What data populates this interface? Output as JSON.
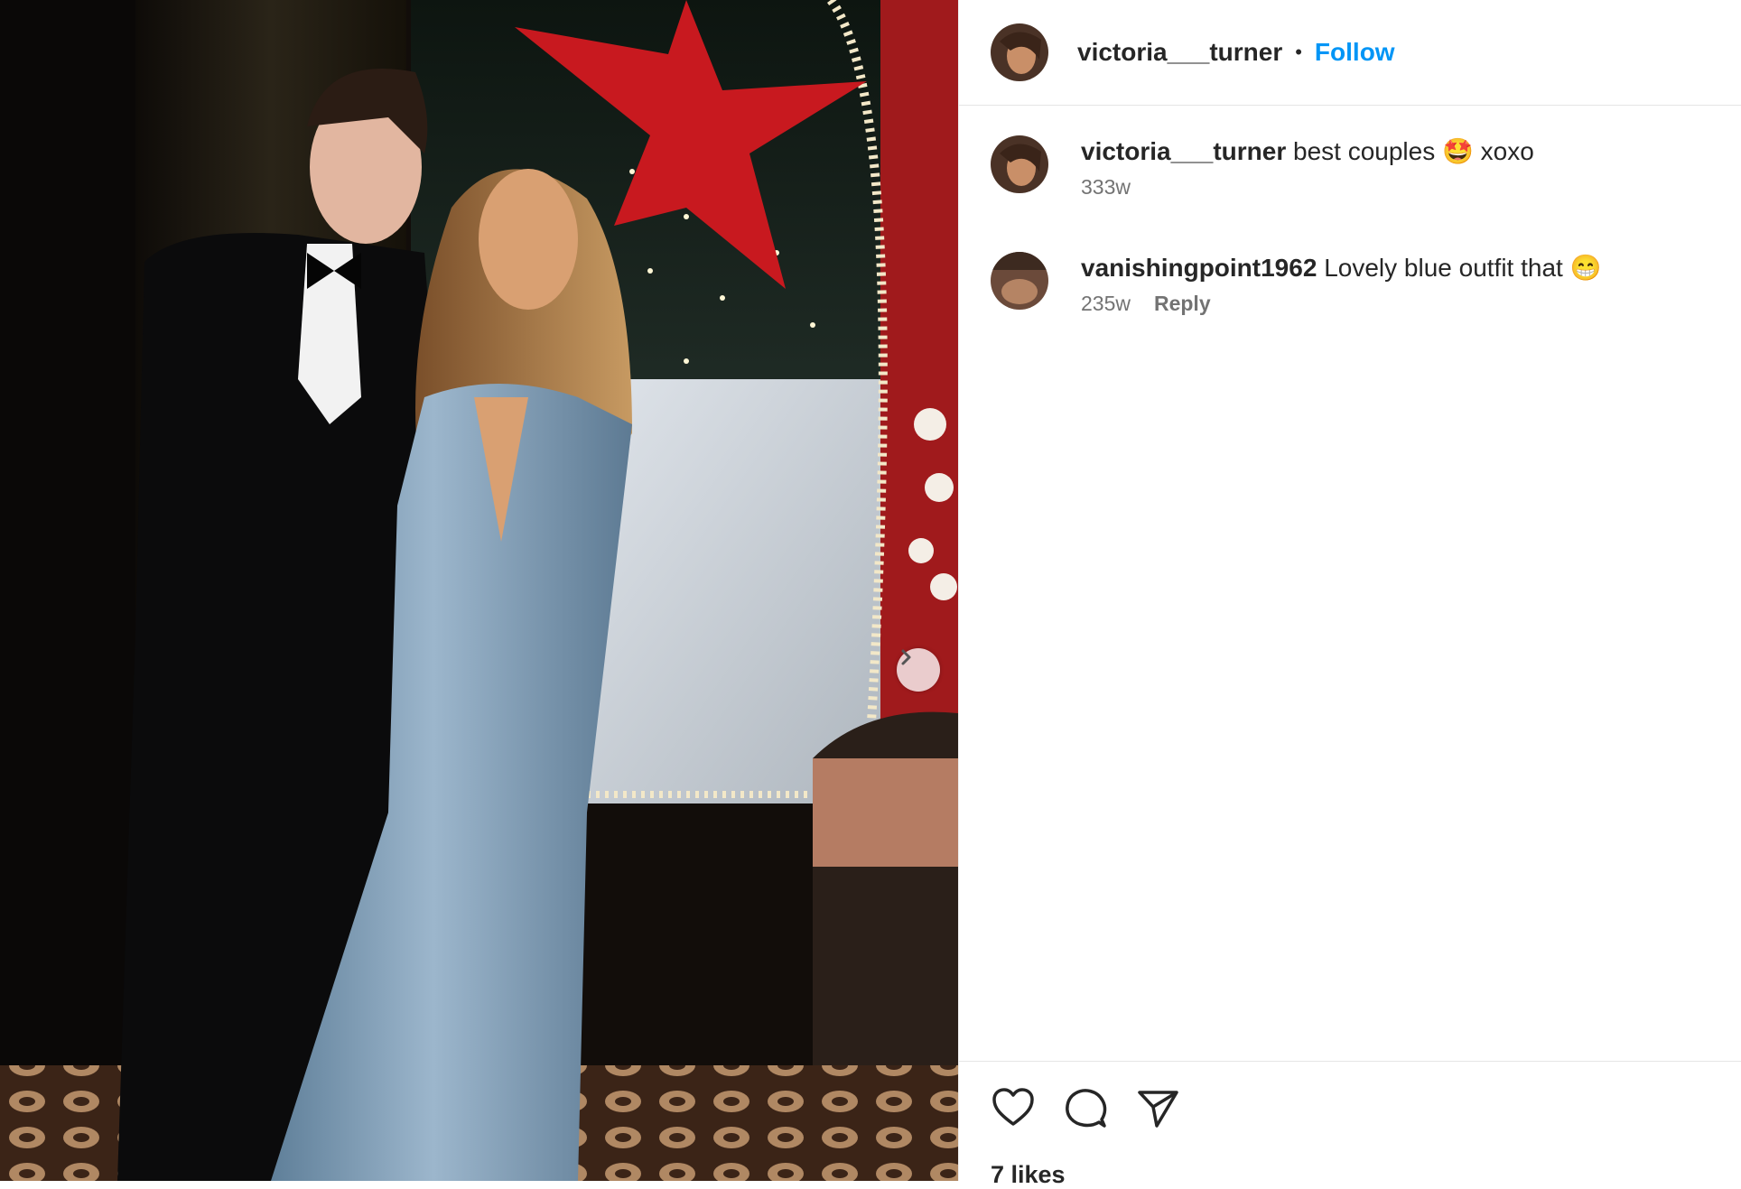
{
  "post": {
    "username": "victoria___turner",
    "follow_label": "Follow",
    "separator": "•"
  },
  "comments": [
    {
      "username": "victoria___turner",
      "text": "best couples 🤩 xoxo",
      "time": "333w",
      "reply": ""
    },
    {
      "username": "vanishingpoint1962",
      "text": "Lovely blue outfit that 😁",
      "time": "235w",
      "reply": "Reply"
    }
  ],
  "likes_label": "7 likes",
  "icons": {
    "next": "chevron-right-icon",
    "like": "heart-icon",
    "comment": "comment-icon",
    "share": "share-icon"
  },
  "colors": {
    "accent": "#0095f6",
    "text": "#262626",
    "muted": "#737373"
  }
}
